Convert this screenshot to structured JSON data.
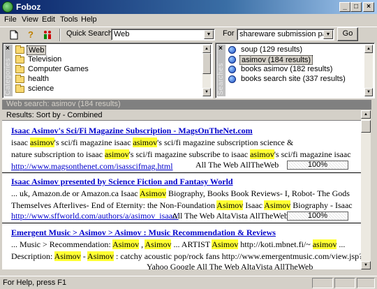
{
  "window": {
    "title": "Foboz"
  },
  "menu": [
    "File",
    "View",
    "Edit",
    "Tools",
    "Help"
  ],
  "toolbar": {
    "quick_search_label": "Quick Search",
    "quick_search_value": "Web",
    "for_label": "For",
    "for_value": "shareware submission pad",
    "go_label": "Go",
    "icons": [
      "new-document-icon",
      "help-icon",
      "users-icon"
    ]
  },
  "categories": {
    "tab_label": "Categories",
    "items": [
      "Web",
      "Television",
      "Computer Games",
      "health",
      "science"
    ],
    "selected": "Web"
  },
  "searches": {
    "tab_label": "Searches",
    "items": [
      "soup (129 results)",
      "asimov (184 results)",
      "books asimov (182 results)",
      "books search site (337 results)"
    ],
    "selected": "asimov (184 results)"
  },
  "results_header": "Web search: asimov (184 results)",
  "sort_label": "Results: Sort by - Combined",
  "results": [
    {
      "title": "Isaac Asimov's Sci/Fi Magazine Subscription - MagsOnTheNet.com",
      "url": "http://www.magsonthenet.com/isasscifmag.html",
      "sources": "All The Web AllTheWeb",
      "relevance": "100%"
    },
    {
      "title": "Isaac Asimov presented by Science Fiction and Fantasy World",
      "url": "http://www.sffworld.com/authors/a/asimov_isaac/",
      "sources": "All The Web AltaVista AllTheWeb",
      "relevance": "100%"
    },
    {
      "title": "Emergent Music > Asimov > Asimov : Music Recommendation & Reviews",
      "sources": "Yahoo Google All The Web AltaVista AllTheWeb"
    }
  ],
  "status": {
    "text": "For Help, press F1"
  },
  "colors": {
    "title_start": "#0a246a",
    "title_end": "#a6caf0",
    "highlight": "#ffff33",
    "link": "#0000cc"
  }
}
